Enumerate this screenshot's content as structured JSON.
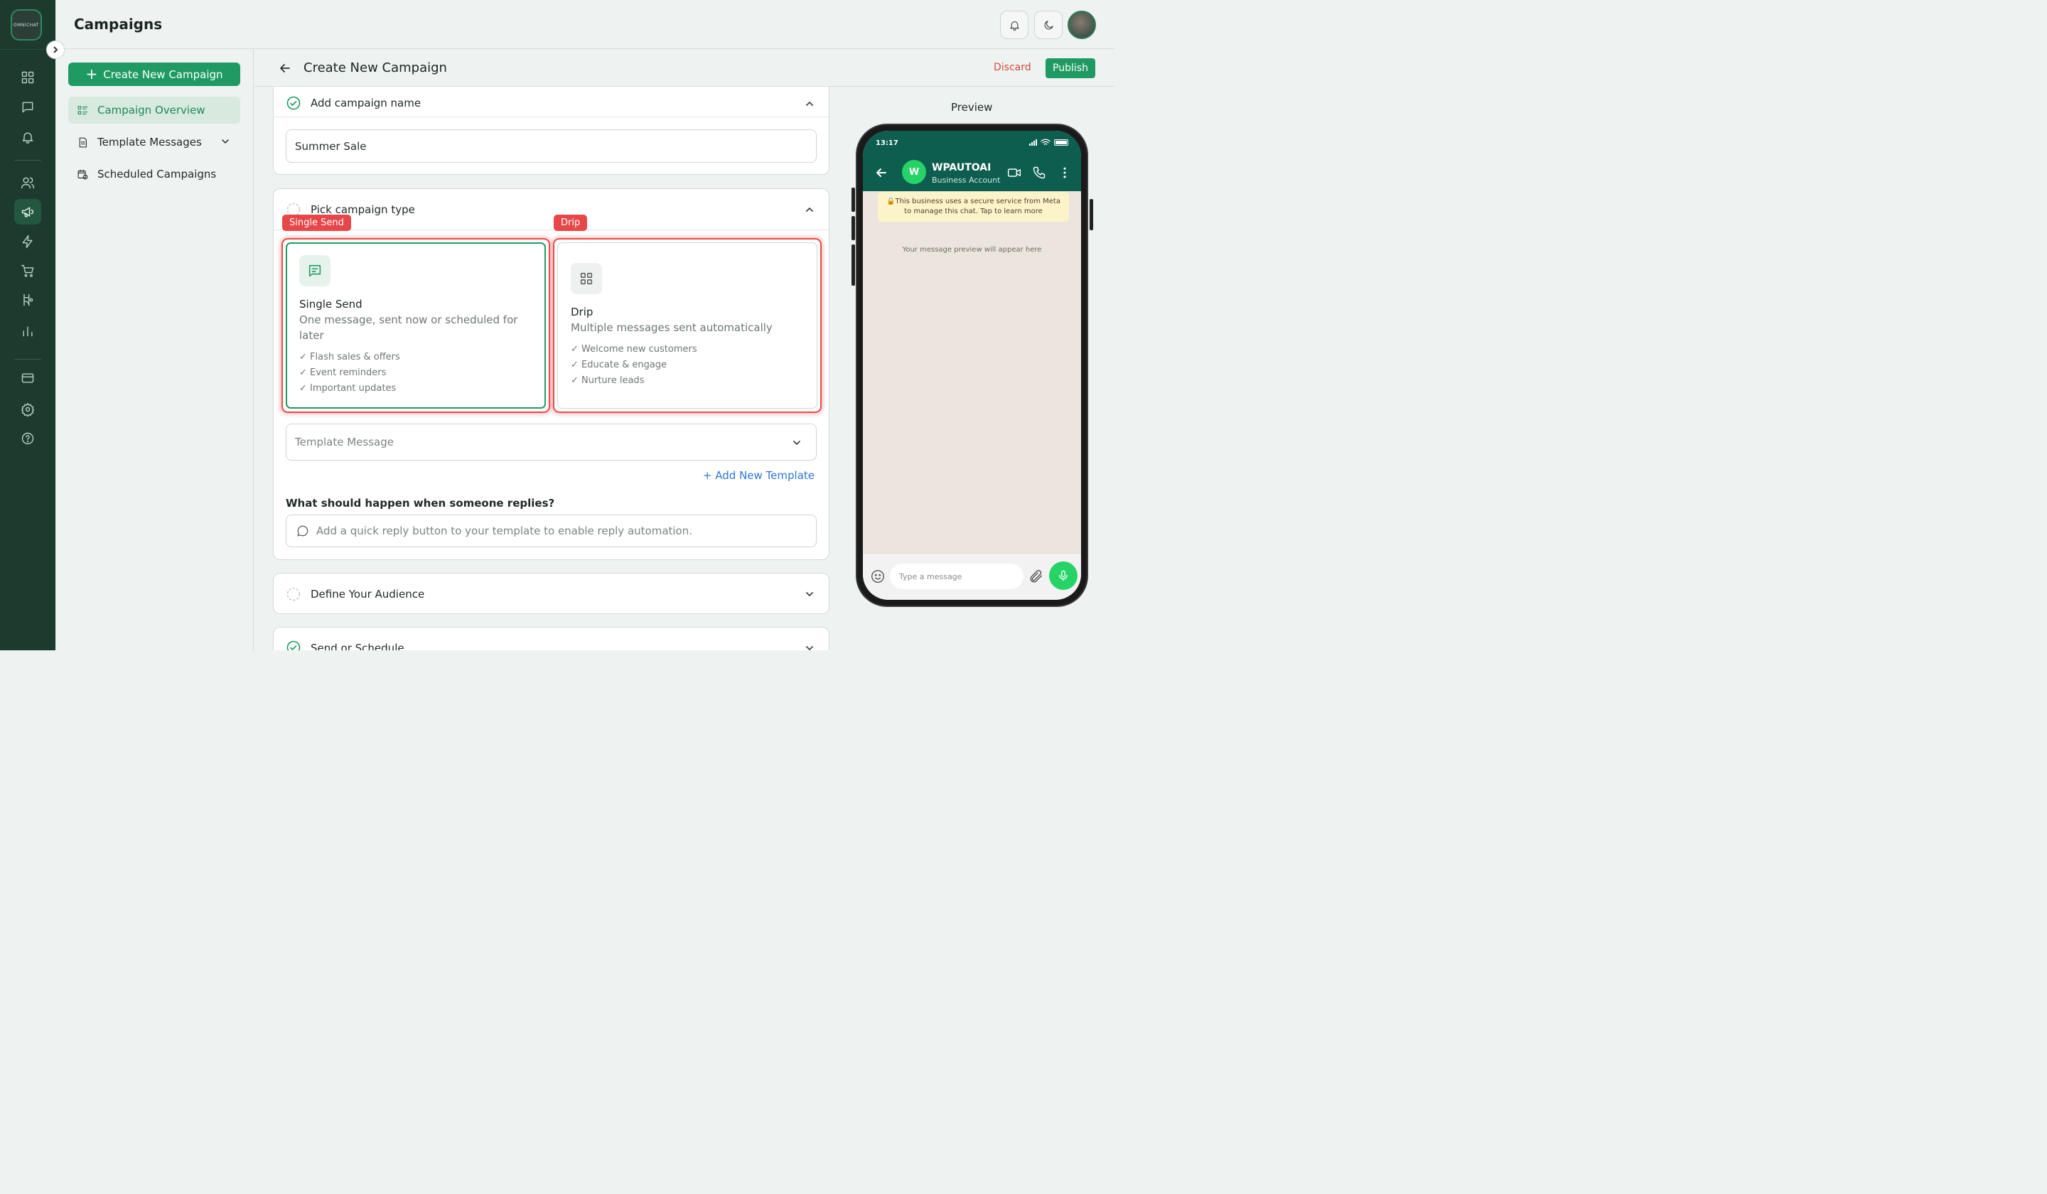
{
  "rail": {
    "logo_text": "OMNICHAT",
    "icons": [
      "dashboard-icon",
      "chat-icon",
      "bell-icon",
      "users-icon",
      "megaphone-icon",
      "bolt-icon",
      "cart-icon",
      "route-icon",
      "chart-icon",
      "card-icon",
      "gear-icon",
      "help-icon"
    ],
    "active": "megaphone-icon"
  },
  "header": {
    "title": "Campaigns"
  },
  "sidebar": {
    "create_label": "Create New Campaign",
    "items": [
      {
        "label": "Campaign Overview",
        "active": true
      },
      {
        "label": "Template Messages",
        "active": false
      },
      {
        "label": "Scheduled Campaigns",
        "active": false
      }
    ]
  },
  "page": {
    "title": "Create New Campaign",
    "discard_label": "Discard",
    "publish_label": "Publish"
  },
  "sections": {
    "name": {
      "label": "Add campaign name",
      "value": "Summer Sale",
      "done": true
    },
    "type": {
      "label": "Pick campaign type",
      "options": [
        {
          "tag": "Single Send",
          "name": "Single Send",
          "desc": "One message, sent now or scheduled for later",
          "features": [
            "✓ Flash sales & offers",
            "✓ Event reminders",
            "✓ Important updates"
          ],
          "selected": true
        },
        {
          "tag": "Drip",
          "name": "Drip",
          "desc": "Multiple messages sent automatically",
          "features": [
            "✓ Welcome new customers",
            "✓ Educate & engage",
            "✓ Nurture leads"
          ],
          "selected": false
        }
      ],
      "template_placeholder": "Template Message",
      "add_template": "+ Add New Template",
      "reply_question": "What should happen when someone replies?",
      "reply_hint": "Add a quick reply button to your template to enable reply automation."
    },
    "audience": {
      "label": "Define Your Audience"
    },
    "schedule": {
      "label": "Send or Schedule"
    }
  },
  "preview": {
    "title": "Preview",
    "time": "13:17",
    "avatar_letter": "W",
    "business_name": "WPAUTOAI",
    "business_sub": "Business Account",
    "notice_line1": "This business uses a secure service from Meta",
    "notice_line2": "to manage this chat. Tap to learn more",
    "hint": "Your message preview will appear here",
    "input_placeholder": "Type a message"
  },
  "colors": {
    "brand": "#1f9a63",
    "rail": "#1c3a2e",
    "highlight": "#e8474a",
    "link": "#2f74d9",
    "danger": "#d94a3d",
    "wa_header": "#0d5e4e",
    "wa_green": "#25d366"
  }
}
